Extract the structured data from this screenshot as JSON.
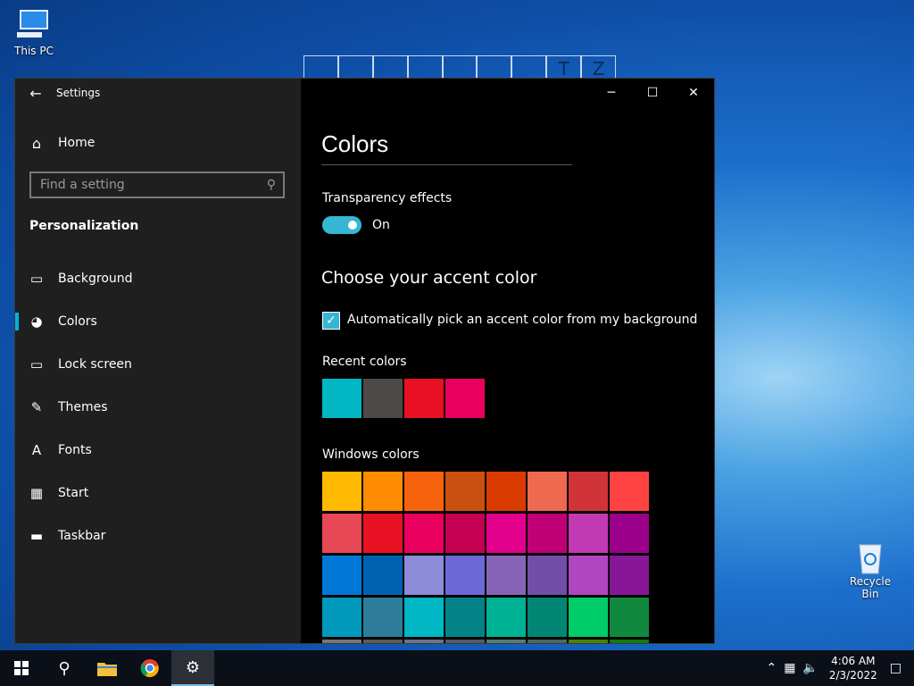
{
  "desktop": {
    "icons": [
      {
        "label": "This PC"
      },
      {
        "label": "Recycle Bin"
      }
    ],
    "deco_letters": [
      "",
      "",
      "",
      "",
      "",
      "",
      "",
      "T",
      "Z"
    ]
  },
  "window": {
    "title": "Settings",
    "controls": {
      "minimize": "─",
      "maximize": "☐",
      "close": "✕"
    }
  },
  "sidebar": {
    "home_label": "Home",
    "search_placeholder": "Find a setting",
    "section": "Personalization",
    "items": [
      {
        "label": "Background",
        "icon": "image-icon",
        "glyph": "▭"
      },
      {
        "label": "Colors",
        "icon": "palette-icon",
        "glyph": "◕",
        "active": true
      },
      {
        "label": "Lock screen",
        "icon": "lock-screen-icon",
        "glyph": "▭"
      },
      {
        "label": "Themes",
        "icon": "brush-icon",
        "glyph": "✎"
      },
      {
        "label": "Fonts",
        "icon": "font-icon",
        "glyph": "A"
      },
      {
        "label": "Start",
        "icon": "start-icon",
        "glyph": "▦"
      },
      {
        "label": "Taskbar",
        "icon": "taskbar-icon",
        "glyph": "▬"
      }
    ]
  },
  "content": {
    "title": "Colors",
    "transparency_label": "Transparency effects",
    "transparency_state": "On",
    "accent_heading": "Choose your accent color",
    "auto_pick_label": "Automatically pick an accent color from my background",
    "recent_label": "Recent colors",
    "recent_colors": [
      "#00b7c3",
      "#4c4a48",
      "#e81123",
      "#ea005e"
    ],
    "windows_label": "Windows colors",
    "windows_colors": [
      "#ffb900",
      "#ff8c00",
      "#f7630c",
      "#ca5010",
      "#da3b01",
      "#ef6950",
      "#d13438",
      "#ff4343",
      "#e74856",
      "#e81123",
      "#ea005e",
      "#c30052",
      "#e3008c",
      "#bf0077",
      "#c239b3",
      "#9a0089",
      "#0078d7",
      "#0063b1",
      "#8e8cd8",
      "#6b69d6",
      "#8764b8",
      "#744da9",
      "#b146c2",
      "#881798",
      "#0099bc",
      "#2d7d9a",
      "#00b7c3",
      "#038387",
      "#00b294",
      "#018574",
      "#00cc6a",
      "#10893e",
      "#7a7574",
      "#5d5a58",
      "#68768a",
      "#515c6b",
      "#567c73",
      "#486860",
      "#498205",
      "#107c10"
    ]
  },
  "taskbar": {
    "time": "4:06 AM",
    "date": "2/3/2022"
  }
}
